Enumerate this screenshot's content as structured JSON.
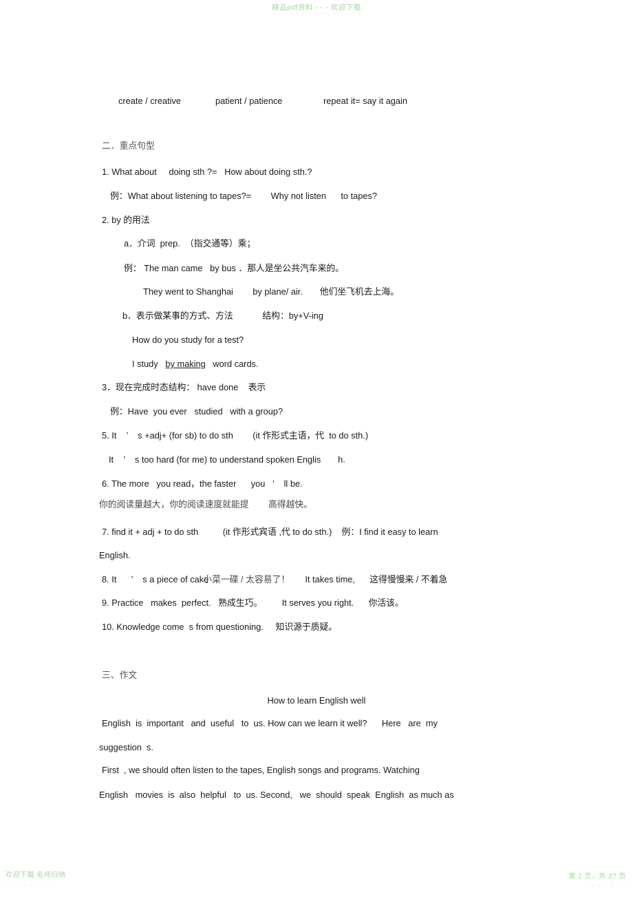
{
  "watermark": {
    "top": "精品pdf资料 - - - 欢迎下载",
    "top_dashes": "- - - - - - - - - - - - - - -",
    "footer_left": "欢迎下载  名师归纳",
    "footer_left_dashes": "- - - - - - - - -",
    "footer_right": "第 2 页，共 27 页",
    "footer_right_dashes": "- - - - - - -",
    "color": "#a6d6a6"
  },
  "vocab_line": {
    "a": "create / creative",
    "b": "patient / patience",
    "c": "repeat it= say it again"
  },
  "section2": {
    "heading": "二．重点句型",
    "item1": "1. What about     doing sth ?=   How about doing sth.?",
    "item1_example": "例：What about listening to tapes?=        Why not listen      to tapes?",
    "item2": "2. by 的用法",
    "item2_a": "a．介词  prep.  （指交通等）乘；",
    "item2_a_example": "例： The man came   by bus ．那人是坐公共汽车来的。",
    "item2_a_example2": "They went to Shanghai        by plane/ air.       他们坐飞机去上海。",
    "item2_b": "b．表示做某事的方式、方法            结构：by+V-ing",
    "item2_b_q": "How do you study for a test?",
    "item2_b_a_pre": "I study",
    "item2_b_a_underlined": "by making",
    "item2_b_a_post": "word cards.",
    "item3": "3．现在完成时态结构： have done    表示",
    "item3_example": "例：Have  you ever   studied   with a group?",
    "item5": "5. It    ’    s +adj+ (for sb) to do sth        (it 作形式主语，代  to do sth.)",
    "item5_example": "It    ’    s too hard (for me) to understand spoken Englis       h.",
    "item6": "6. The more   you read，the faster      you   ’    ll be.",
    "item6_cn": "你的阅读量越大，你的阅读速度就能提        高得越快。",
    "item7": "7. find it + adj + to do sth          (it 作形式宾语 ,代 to do sth.)    例：I find it easy to learn",
    "item7_cont": "English.",
    "item8_pre": "8. It      ’    s a piece of cake",
    "item8_overlap": "小菜一碟 / 太容易了！",
    "item8_post": "It takes time,      这得慢慢来 / 不着急",
    "item9": "9. Practice   makes  perfect.   熟成生巧。        It serves you right.      你活该。",
    "item10": "10. Knowledge come  s from questioning.     知识源于质疑。"
  },
  "section3": {
    "heading": "三、作文",
    "essay_title": "How to learn English well",
    "para1_line1": "English  is  important   and  useful   to  us. How can we learn it well?      Here   are  my",
    "para1_line2": "suggestion  s.",
    "para2_line1": "First  , we should often listen to the tapes, English songs and programs. Watching",
    "para2_line2": "English   movies  is  also  helpful   to  us. Second,   we  should  speak  English  as much as"
  }
}
